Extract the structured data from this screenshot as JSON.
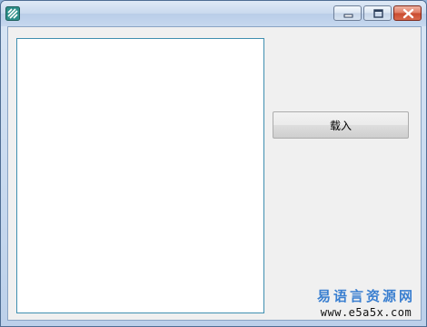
{
  "window": {
    "icon": "app-icon",
    "controls": {
      "minimize_icon": "minimize-icon",
      "maximize_icon": "maximize-icon",
      "close_icon": "close-icon"
    }
  },
  "main": {
    "load_button_label": "载入"
  },
  "watermark": {
    "site_name": "易语言资源网",
    "url": "www.e5a5x.com"
  }
}
